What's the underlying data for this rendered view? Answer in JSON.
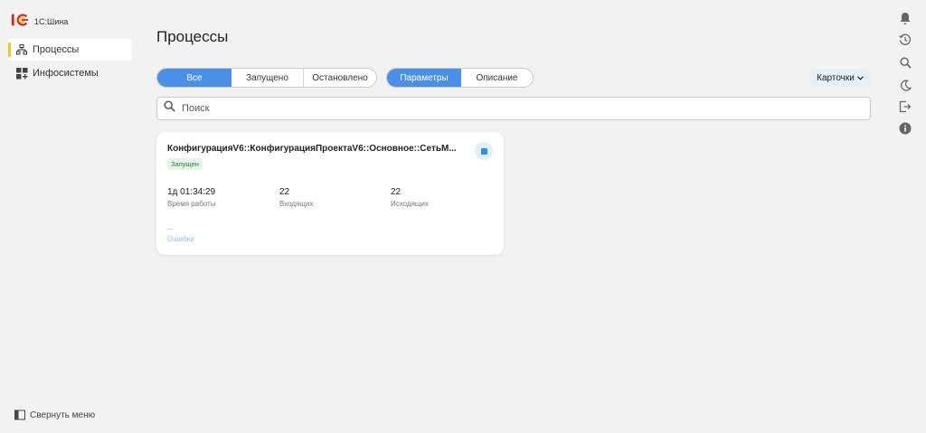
{
  "app": {
    "logo_text": "1С:Шина"
  },
  "sidebar": {
    "items": [
      {
        "label": "Процессы",
        "icon": "hierarchy-icon",
        "active": true
      },
      {
        "label": "Инфосистемы",
        "icon": "grid-plus-icon",
        "active": false
      }
    ],
    "collapse_label": "Свернуть меню"
  },
  "main": {
    "title": "Процессы",
    "status_filter": [
      "Все",
      "Запущено",
      "Остановлено"
    ],
    "status_filter_selected": "Все",
    "info_tabs": [
      "Параметры",
      "Описание"
    ],
    "info_tabs_selected": "Параметры",
    "view_label": "Карточки",
    "search": {
      "placeholder": "Поиск",
      "value": ""
    },
    "cards": [
      {
        "title": "КонфигурацияV6::КонфигурацияПроектаV6::Основное::СетьМ...",
        "status": "Запущен",
        "uptime_value": "1д 01:34:29",
        "uptime_label": "Время работы",
        "incoming_value": "22",
        "incoming_label": "Входящих",
        "outgoing_value": "22",
        "outgoing_label": "Исходящих",
        "errors_value": "--",
        "errors_label": "Ошибки"
      }
    ]
  },
  "right_rail": [
    "bell-icon",
    "history-icon",
    "search-icon",
    "moon-icon",
    "exit-icon",
    "info-icon"
  ],
  "colors": {
    "accent": "#4a8fe8",
    "logo_yellow": "#f5c518",
    "logo_red": "#d9251d",
    "status_green_bg": "#e2f5e6",
    "status_green_text": "#2f7a3b",
    "stop_blue": "#1e9be8"
  }
}
